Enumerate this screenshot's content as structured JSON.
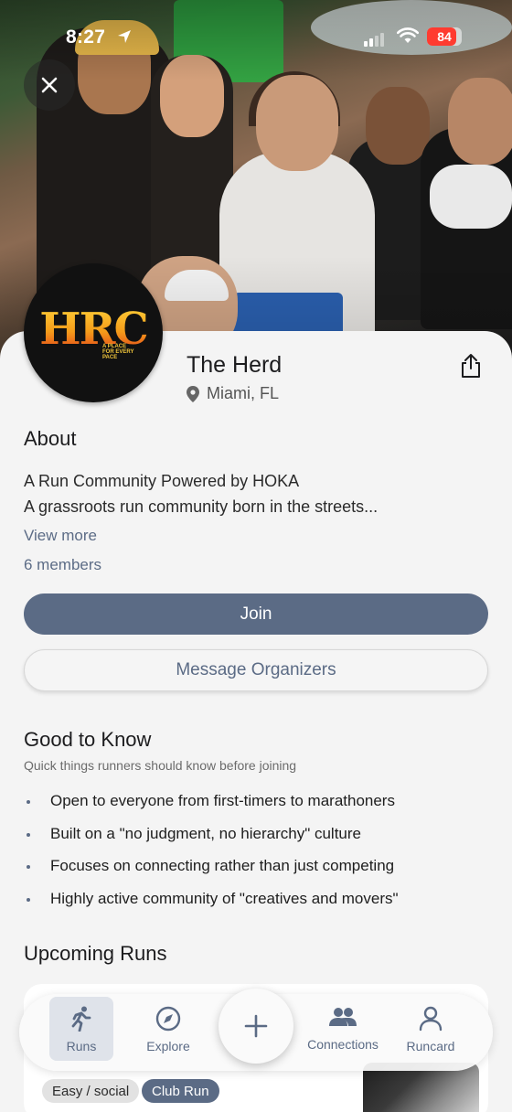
{
  "status_bar": {
    "time": "8:27",
    "battery": "84",
    "battery_level": 0.84
  },
  "club": {
    "name": "The Herd",
    "location": "Miami, FL",
    "logo_text": "HRC",
    "logo_tagline": "A PLACE FOR EVERY PACE"
  },
  "about": {
    "heading": "About",
    "line1": "A Run Community Powered by HOKA",
    "line2": "A grassroots run community born in the streets...",
    "view_more": "View more",
    "members": "6 members"
  },
  "actions": {
    "join": "Join",
    "message": "Message Organizers"
  },
  "good_to_know": {
    "heading": "Good to Know",
    "subtitle": "Quick things runners should know before joining",
    "items": [
      "Open to everyone from first-timers to marathoners",
      "Built on a \"no judgment, no hierarchy\" culture",
      "Focuses on connecting rather than just competing",
      "Highly active community of \"creatives and movers\""
    ]
  },
  "upcoming": {
    "heading": "Upcoming Runs",
    "chips": [
      "Easy / social",
      "Club Run"
    ]
  },
  "tabbar": {
    "runs": "Runs",
    "explore": "Explore",
    "connections": "Connections",
    "runcard": "Runcard"
  },
  "colors": {
    "accent": "#5b6b85",
    "background": "#f4f4f4"
  },
  "icons": {
    "close": "close-icon",
    "share": "share-icon",
    "location": "location-pin-icon",
    "runs": "runner-icon",
    "explore": "compass-icon",
    "add": "plus-icon",
    "connections": "people-icon",
    "runcard": "person-icon"
  }
}
